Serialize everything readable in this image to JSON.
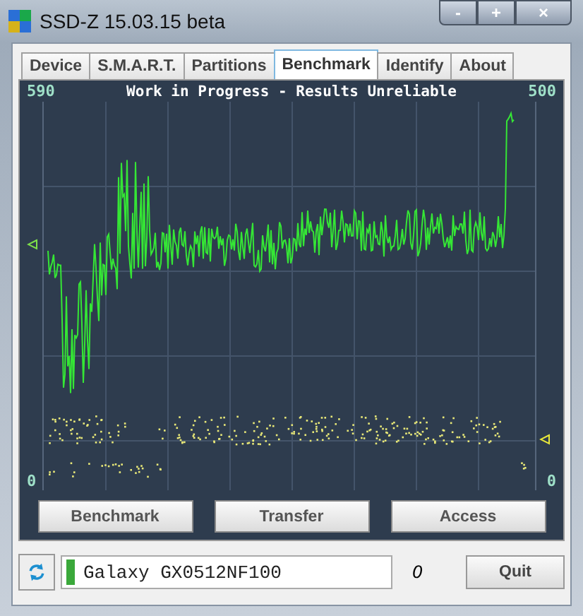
{
  "window": {
    "title": "SSD-Z 15.03.15 beta",
    "controls": [
      "-",
      "+",
      "×"
    ]
  },
  "tabs": [
    {
      "label": "Device",
      "selected": false
    },
    {
      "label": "S.M.A.R.T.",
      "selected": false
    },
    {
      "label": "Partitions",
      "selected": false
    },
    {
      "label": "Benchmark",
      "selected": true
    },
    {
      "label": "Identify",
      "selected": false
    },
    {
      "label": "About",
      "selected": false
    }
  ],
  "graph": {
    "title": "Work in Progress - Results Unreliable",
    "left_max": "590",
    "left_min": "0",
    "right_max": "500",
    "right_min": "0"
  },
  "buttons": [
    "Benchmark",
    "Transfer",
    "Access"
  ],
  "status_bar": {
    "drive": "Galaxy GX0512NF100",
    "drive_ok": true,
    "index": "0",
    "quit": "Quit"
  }
}
